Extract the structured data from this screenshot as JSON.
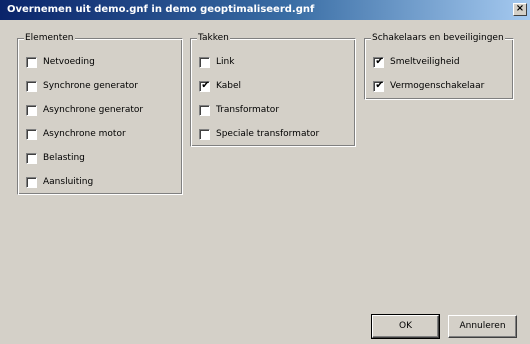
{
  "window": {
    "title": "Overnemen uit demo.gnf in demo geoptimaliseerd.gnf",
    "close_label": "×"
  },
  "groups": {
    "elementen": {
      "label": "Elementen",
      "items": [
        {
          "label": "Netvoeding",
          "checked": false
        },
        {
          "label": "Synchrone generator",
          "checked": false
        },
        {
          "label": "Asynchrone generator",
          "checked": false
        },
        {
          "label": "Asynchrone motor",
          "checked": false
        },
        {
          "label": "Belasting",
          "checked": false
        },
        {
          "label": "Aansluiting",
          "checked": false
        }
      ]
    },
    "takken": {
      "label": "Takken",
      "items": [
        {
          "label": "Link",
          "checked": false
        },
        {
          "label": "Kabel",
          "checked": true
        },
        {
          "label": "Transformator",
          "checked": false
        },
        {
          "label": "Speciale transformator",
          "checked": false
        }
      ]
    },
    "schakelaars": {
      "label": "Schakelaars en beveiligingen",
      "items": [
        {
          "label": "Smeltveiligheid",
          "checked": true
        },
        {
          "label": "Vermogenschakelaar",
          "checked": true
        }
      ]
    }
  },
  "buttons": {
    "ok_label": "OK",
    "cancel_label": "Annuleren"
  },
  "checkmark": "✔"
}
